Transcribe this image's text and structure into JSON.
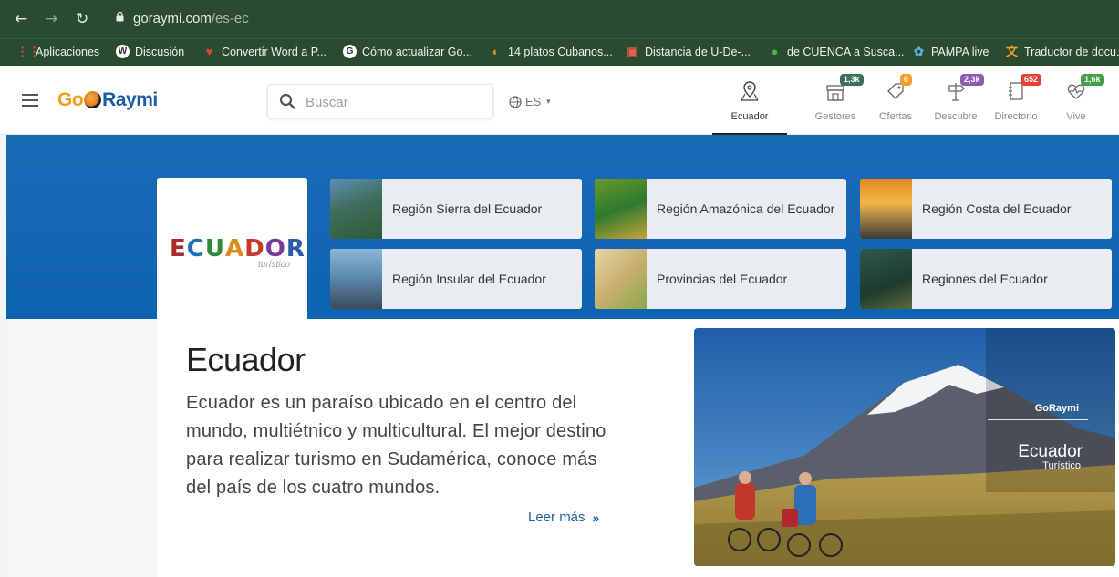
{
  "browser": {
    "url_host": "goraymi.com",
    "url_path": "/es-ec",
    "bookmarks": [
      {
        "label": "Aplicaciones",
        "icon": "apps-grid-icon",
        "color": "#e84a3c"
      },
      {
        "label": "Discusión",
        "icon": "wikipedia-icon",
        "color": "#ffffff"
      },
      {
        "label": "Convertir Word a P...",
        "icon": "heart-icon",
        "color": "#e0433b"
      },
      {
        "label": "Cómo actualizar Go...",
        "icon": "google-icon",
        "color": "#ffffff"
      },
      {
        "label": "14 platos Cubanos...",
        "icon": "bookmark-icon",
        "color": "#f28c1b"
      },
      {
        "label": "Distancia de U-De-...",
        "icon": "map-icon",
        "color": "#e85d4a"
      },
      {
        "label": "de CUENCA a Susca...",
        "icon": "maps-pin-icon",
        "color": "#4caf50"
      },
      {
        "label": "PAMPA live",
        "icon": "leaf-icon",
        "color": "#5fb0d8"
      },
      {
        "label": "Traductor de docu...",
        "icon": "translate-icon",
        "color": "#f2a02b"
      }
    ]
  },
  "header": {
    "search_placeholder": "Buscar",
    "language": "ES",
    "nav": [
      {
        "label": "Ecuador",
        "icon": "map-pin-icon",
        "badge": "",
        "badge_color": "",
        "active": true
      },
      {
        "label": "Gestores",
        "icon": "storefront-icon",
        "badge": "1,3k",
        "badge_color": "#3d6f5a",
        "active": false
      },
      {
        "label": "Ofertas",
        "icon": "tag-icon",
        "badge": "6",
        "badge_color": "#f2a02b",
        "active": false
      },
      {
        "label": "Descubre",
        "icon": "signpost-icon",
        "badge": "2,3k",
        "badge_color": "#8e5bb5",
        "active": false
      },
      {
        "label": "Directorio",
        "icon": "notebook-icon",
        "badge": "652",
        "badge_color": "#e0433b",
        "active": false
      },
      {
        "label": "Vive",
        "icon": "heartbeat-icon",
        "badge": "1,6k",
        "badge_color": "#43a047",
        "active": false
      }
    ]
  },
  "logo": {
    "go": "Go",
    "raymi": "Raymi"
  },
  "banner": {
    "card_logo_text": "ECUADOR",
    "card_logo_sub": "turístico",
    "regions": [
      "Región Sierra del Ecuador",
      "Región Amazónica del Ecuador",
      "Región Costa del Ecuador",
      "Región Insular del Ecuador",
      "Provincias del Ecuador",
      "Regiones del Ecuador"
    ]
  },
  "main": {
    "title": "Ecuador",
    "description": "Ecuador es un paraíso ubicado en el centro del mundo, multiétnico y multicultural. El mejor destino para realizar turismo en Sudamérica, conoce más del país de los cuatro mundos.",
    "read_more": "Leer más",
    "photo_overlay_brand": "GoRaymi",
    "photo_overlay_title": "Ecuador",
    "photo_overlay_sub": "Turístico"
  }
}
